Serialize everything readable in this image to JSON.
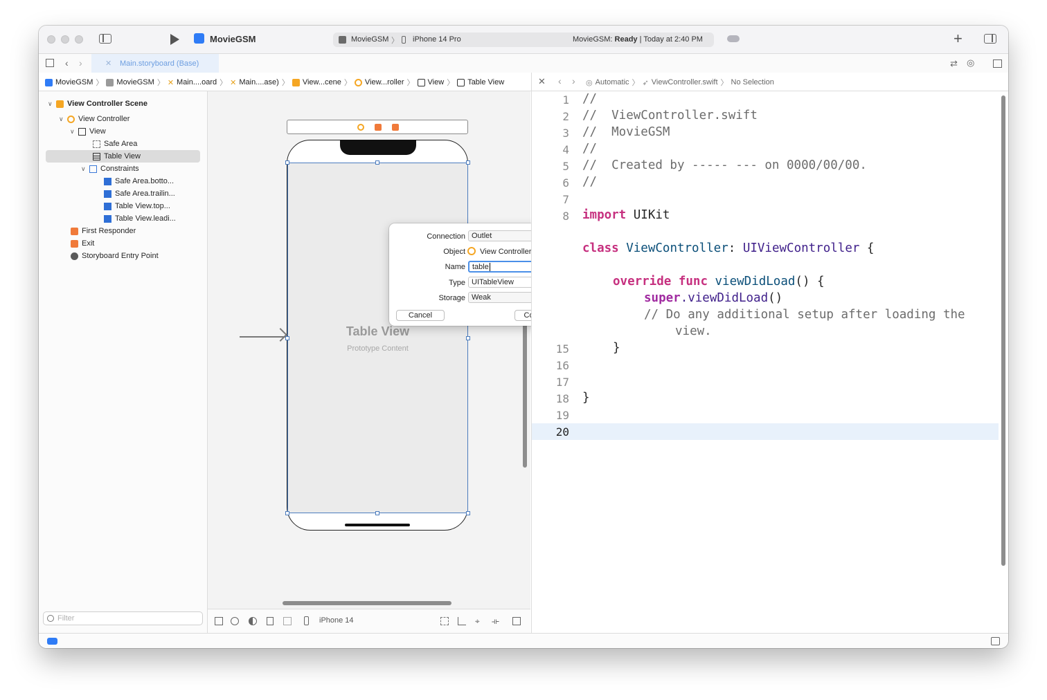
{
  "titlebar": {
    "project": "MovieGSM",
    "scheme_target": "MovieGSM",
    "scheme_device": "iPhone 14 Pro",
    "status_project": "MovieGSM:",
    "status_state": "Ready",
    "status_time": "| Today at 2:40 PM",
    "add_icon": "+"
  },
  "tab": {
    "label": "Main.storyboard (Base)"
  },
  "jumpbar_left": [
    "MovieGSM",
    "MovieGSM",
    "Main....oard",
    "Main....ase)",
    "View...cene",
    "View...roller",
    "View",
    "Table View"
  ],
  "jumpbar_right": {
    "mode": "Automatic",
    "file": "ViewController.swift",
    "selection": "No Selection"
  },
  "navigator": {
    "scene": "View Controller Scene",
    "items": [
      "View Controller",
      "View",
      "Safe Area",
      "Table View",
      "Constraints",
      "Safe Area.botto...",
      "Safe Area.trailin...",
      "Table View.top...",
      "Table View.leadi...",
      "First Responder",
      "Exit",
      "Storyboard Entry Point"
    ],
    "filter_placeholder": "Filter"
  },
  "canvas": {
    "title": "Table View",
    "subtitle": "Prototype Content",
    "device": "iPhone 14"
  },
  "popover": {
    "connection_label": "Connection",
    "connection_value": "Outlet",
    "object_label": "Object",
    "object_value": "View Controller",
    "name_label": "Name",
    "name_value": "table",
    "type_label": "Type",
    "type_value": "UITableView",
    "storage_label": "Storage",
    "storage_value": "Weak",
    "cancel": "Cancel",
    "connect": "Connect"
  },
  "code": {
    "line_numbers": [
      "1",
      "2",
      "3",
      "4",
      "5",
      "6",
      "7",
      "8",
      "15",
      "16",
      "17",
      "18",
      "19",
      "20"
    ],
    "l1": "//",
    "l2": "//  ViewController.swift",
    "l3": "//  MovieGSM",
    "l4": "//",
    "l5": "//  Created by ----- --- on 0000/00/00.",
    "l6": "//",
    "l8_kw": "import",
    "l8_rest": " UIKit",
    "class_kw": "class",
    "class_name": " ViewController",
    "class_colon": ": ",
    "class_super": "UIViewController",
    "class_brace": " {",
    "override_kw": "override",
    "func_kw": " func",
    "func_name": " viewDidLoad",
    "func_tail": "() {",
    "super_kw": "super",
    "super_call": ".viewDidLoad",
    "super_tail": "()",
    "comment_a": "// Do any additional setup after loading the",
    "comment_b": "view.",
    "close_inner": "}",
    "close_outer": "}"
  },
  "colors": {
    "keyword": "#c6307f",
    "type": "#3f1f8a",
    "comment": "#6c6c6c",
    "accent": "#2f7cf6",
    "selection": "#dcdcdc"
  }
}
